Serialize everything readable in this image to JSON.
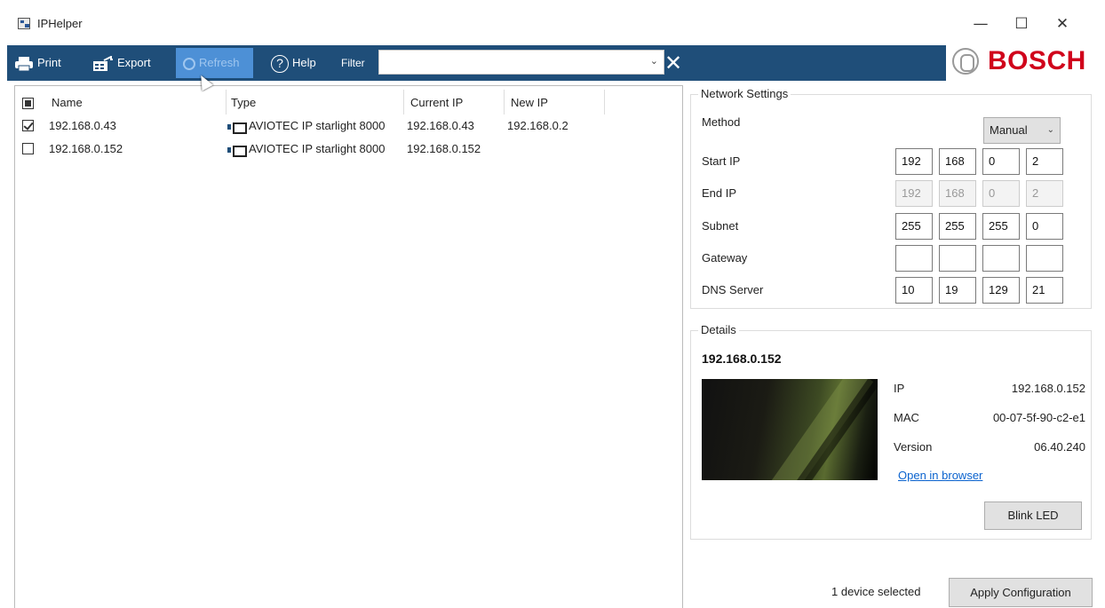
{
  "window": {
    "title": "IPHelper",
    "controls": {
      "minimize": "—",
      "maximize": "☐",
      "close": "✕"
    }
  },
  "toolbar": {
    "print_label": "Print",
    "export_label": "Export",
    "refresh_label": "Refresh",
    "help_label": "Help",
    "filter_label": "Filter",
    "filter_value": "",
    "clear_icon": "✕",
    "brand_name": "BOSCH",
    "brand_color": "#d0021b",
    "toolbar_color": "#1f4e79"
  },
  "device_list": {
    "columns": [
      "Name",
      "Type",
      "Current IP",
      "New IP"
    ],
    "select_all_state": "partial",
    "rows": [
      {
        "checked": true,
        "name": "192.168.0.43",
        "type": "AVIOTEC IP starlight 8000",
        "current_ip": "192.168.0.43",
        "new_ip": "192.168.0.2"
      },
      {
        "checked": false,
        "name": "192.168.0.152",
        "type": "AVIOTEC IP starlight 8000",
        "current_ip": "192.168.0.152",
        "new_ip": ""
      }
    ]
  },
  "network_settings": {
    "title": "Network Settings",
    "method_label": "Method",
    "method_value": "Manual",
    "start_ip_label": "Start IP",
    "start_ip": [
      "192",
      "168",
      "0",
      "2"
    ],
    "end_ip_label": "End IP",
    "end_ip": [
      "192",
      "168",
      "0",
      "2"
    ],
    "subnet_label": "Subnet",
    "subnet": [
      "255",
      "255",
      "255",
      "0"
    ],
    "gateway_label": "Gateway",
    "gateway": [
      "",
      "",
      "",
      ""
    ],
    "dns_label": "DNS Server",
    "dns": [
      "10",
      "19",
      "129",
      "21"
    ]
  },
  "details": {
    "title": "Details",
    "device_ip": "192.168.0.152",
    "ip_label": "IP",
    "ip_value": "192.168.0.152",
    "mac_label": "MAC",
    "mac_value": "00-07-5f-90-c2-e1",
    "version_label": "Version",
    "version_value": "06.40.240",
    "open_link": "Open in browser",
    "blink_label": "Blink LED"
  },
  "status": {
    "selection_text": "1 device selected",
    "apply_label": "Apply Configuration"
  }
}
